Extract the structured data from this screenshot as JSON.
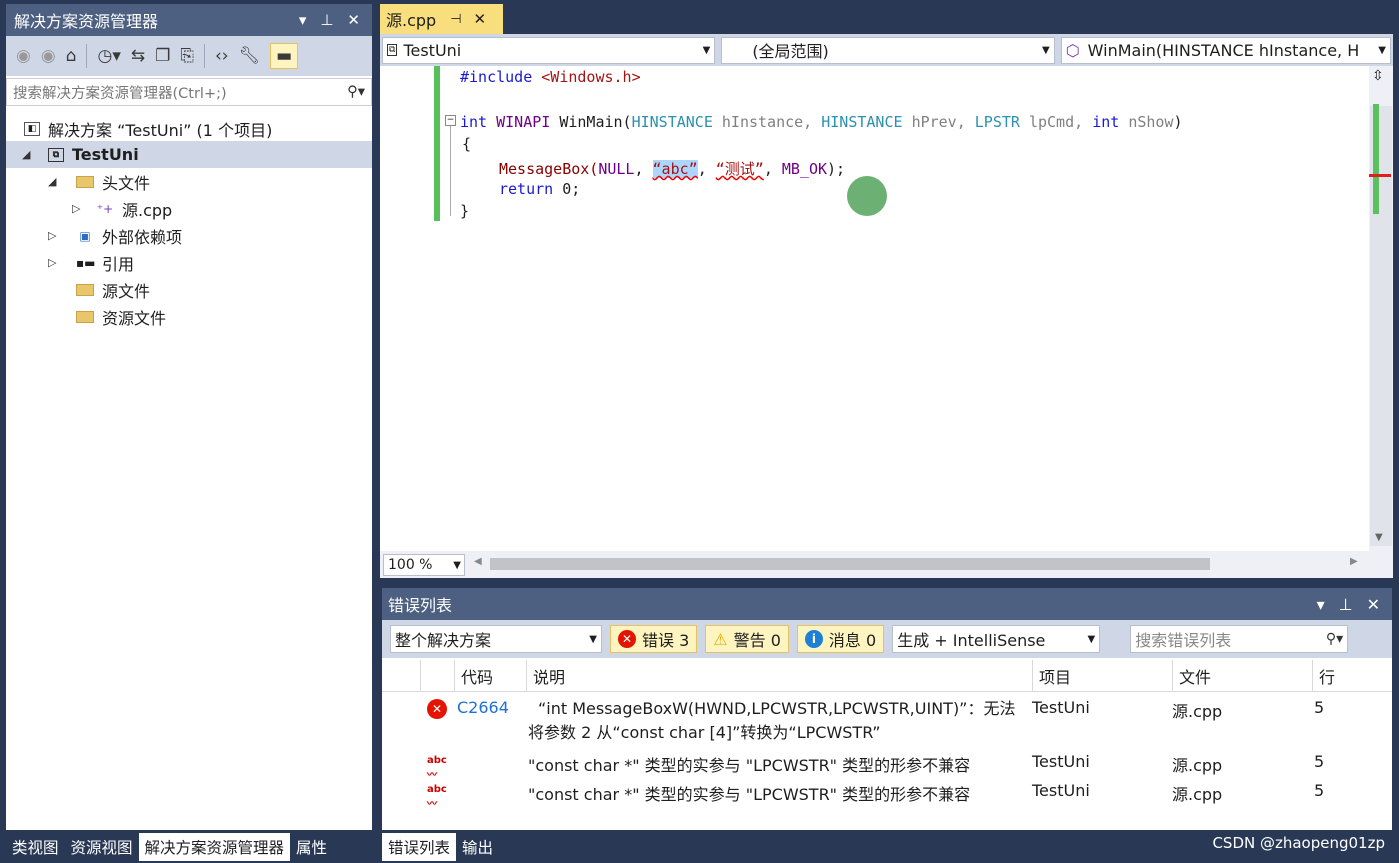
{
  "solution_explorer": {
    "title": "解决方案资源管理器",
    "search_placeholder": "搜索解决方案资源管理器(Ctrl+;)",
    "tree": [
      {
        "label": "解决方案 “TestUni” (1 个项目)"
      },
      {
        "label": "TestUni"
      },
      {
        "label": "头文件"
      },
      {
        "label": "源.cpp"
      },
      {
        "label": "外部依赖项"
      },
      {
        "label": "引用"
      },
      {
        "label": "源文件"
      },
      {
        "label": "资源文件"
      }
    ],
    "bottom_tabs": [
      "类视图",
      "资源视图",
      "解决方案资源管理器",
      "属性"
    ]
  },
  "editor": {
    "tab_label": "源.cpp",
    "nav": {
      "project": "TestUni",
      "scope": "(全局范围)",
      "member": "WinMain(HINSTANCE hInstance, H"
    },
    "zoom": "100 %",
    "code": {
      "l1_prep": "#include ",
      "l1_hdr": "<Windows.h>",
      "l2_kw": "int ",
      "l2_mac": "WINAPI ",
      "l2_fn": "WinMain(",
      "l2_t1": "HINSTANCE ",
      "l2_p1": "hInstance, ",
      "l2_t2": "HINSTANCE ",
      "l2_p2": "hPrev, ",
      "l2_t3": "LPSTR ",
      "l2_p3": "lpCmd, ",
      "l2_t4": "int ",
      "l2_p4": "nShow",
      "l2_end": ")",
      "l3": "{",
      "l4_fn": "MessageBox(",
      "l4_null": "NULL",
      ", ": ", ",
      "l4_s1": "“abc”",
      "l4_s2": "“测试”",
      "l4_mb": "MB_OK",
      "l4_end": ");",
      "l5_kw": "return",
      "l5_rest": " 0;",
      "l6": "}"
    }
  },
  "error_list": {
    "title": "错误列表",
    "scope": "整个解决方案",
    "errors_chip": "错误 3",
    "warnings_chip": "警告 0",
    "messages_chip": "消息 0",
    "build_filter": "生成 + IntelliSense",
    "search_placeholder": "搜索错误列表",
    "headers": {
      "code": "代码",
      "desc": "说明",
      "project": "项目",
      "file": "文件",
      "line": "行"
    },
    "rows": [
      {
        "code": "C2664",
        "desc1": "“int MessageBoxW(HWND,LPCWSTR,LPCWSTR,UINT)”：无法",
        "desc2": "将参数 2 从“const char [4]”转换为“LPCWSTR”",
        "project": "TestUni",
        "file": "源.cpp",
        "line": "5"
      },
      {
        "code": "",
        "desc1": "\"const char *\" 类型的实参与 \"LPCWSTR\" 类型的形参不兼容",
        "desc2": "",
        "project": "TestUni",
        "file": "源.cpp",
        "line": "5"
      },
      {
        "code": "",
        "desc1": "\"const char *\" 类型的实参与 \"LPCWSTR\" 类型的形参不兼容",
        "desc2": "",
        "project": "TestUni",
        "file": "源.cpp",
        "line": "5"
      }
    ],
    "bottom_tabs": [
      "错误列表",
      "输出"
    ]
  },
  "watermark": "CSDN @zhaopeng01zp"
}
